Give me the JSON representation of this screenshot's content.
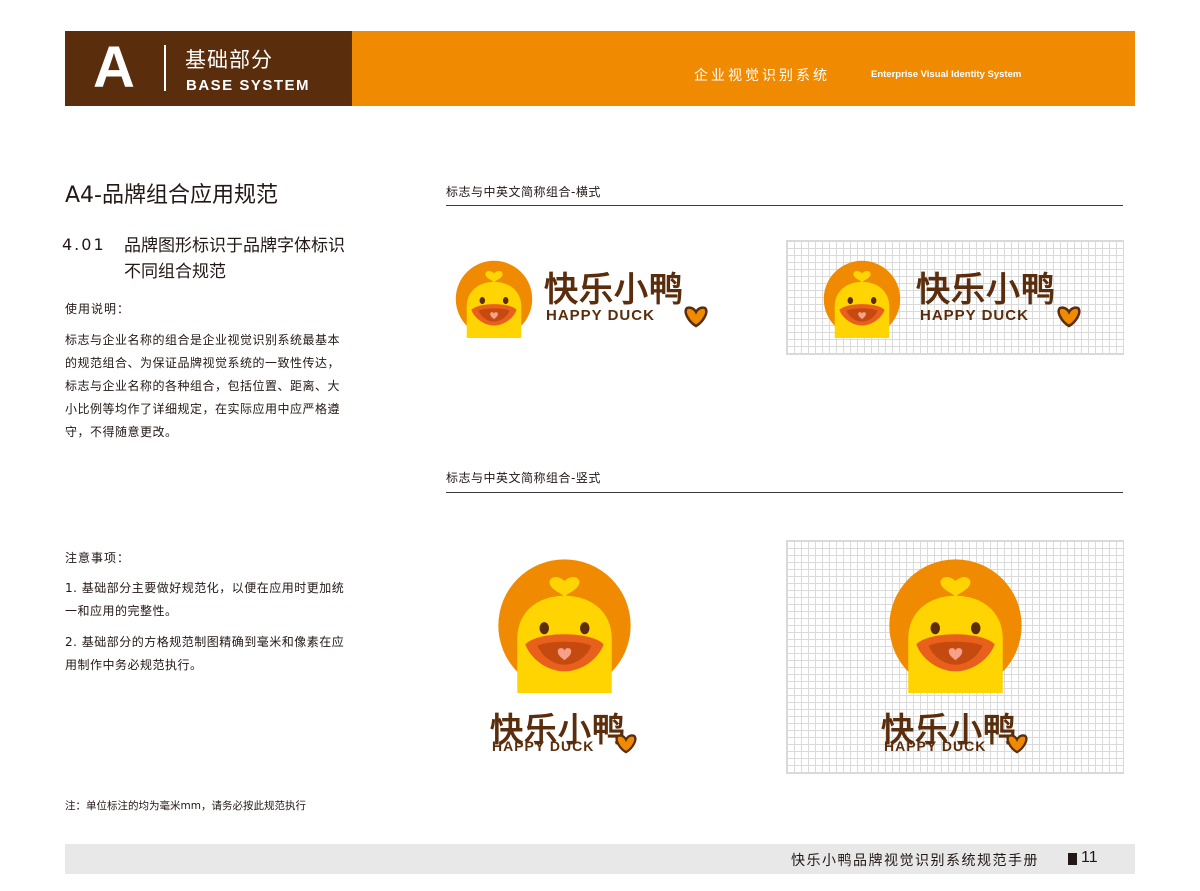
{
  "header": {
    "letter": "A",
    "section_cn": "基础部分",
    "section_en": "BASE SYSTEM",
    "title_cn": "企业视觉识别系统",
    "title_en": "Enterprise Visual Identity System",
    "colors": {
      "brown": "#5a2d0c",
      "orange": "#f08a00"
    }
  },
  "left": {
    "section_title": "A4-品牌组合应用规范",
    "sub_number": "4.01",
    "sub_title": "品牌图形标识于品牌字体标识不同组合规范",
    "usage_label": "使用说明：",
    "usage_text": "标志与企业名称的组合是企业视觉识别系统最基本的规范组合、为保证品牌视觉系统的一致性传达，标志与企业名称的各种组合，包括位置、距离、大小比例等均作了详细规定，在实际应用中应严格遵守，不得随意更改。",
    "notes_label": "注意事项：",
    "note1": "1. 基础部分主要做好规范化，以便在应用时更加统一和应用的完整性。",
    "note2": "2. 基础部分的方格规范制图精确到毫米和像素在应用制作中务必规范执行。",
    "footnote": "注：单位标注的均为毫米mm，请务必按此规范执行"
  },
  "right": {
    "caption_horizontal": "标志与中英文简称组合-横式",
    "caption_vertical": "标志与中英文简称组合-竖式"
  },
  "brand": {
    "name_cn": "快乐小鸭",
    "name_en": "HAPPY DUCK",
    "colors": {
      "circle": "#f08a00",
      "duck": "#ffd400",
      "beak": "#e8601c",
      "text": "#5a2d0c"
    }
  },
  "footer": {
    "title": "快乐小鸭品牌视觉识别系统规范手册",
    "page": "11"
  }
}
